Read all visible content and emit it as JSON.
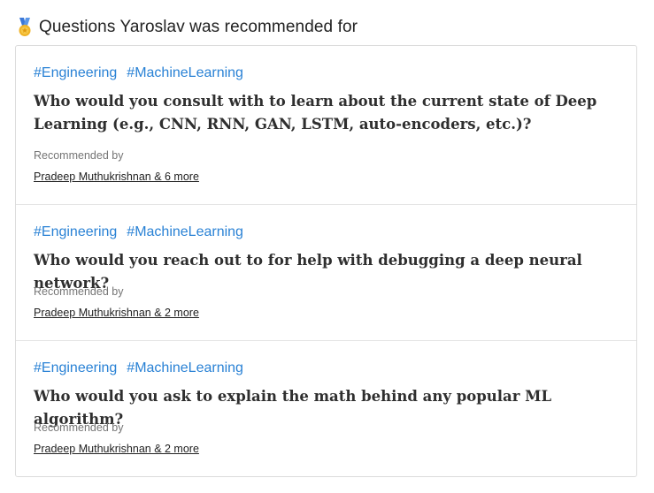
{
  "header": {
    "icon": "medal-icon",
    "title": "Questions Yaroslav was recommended for"
  },
  "colors": {
    "tag": "#2a82d5",
    "question": "#2f2f2f",
    "border": "#dcdcdc"
  },
  "questions": [
    {
      "tags": [
        "#Engineering",
        "#MachineLearning"
      ],
      "text": "Who would you consult with to learn about the current state of Deep Learning (e.g., CNN, RNN, GAN, LSTM, auto-encoders, etc.)?",
      "recommended_label": "Recommended by",
      "recommended_by": "Pradeep Muthukrishnan & 6 more"
    },
    {
      "tags": [
        "#Engineering",
        "#MachineLearning"
      ],
      "text": "Who would you reach out to for help with debugging a deep neural network?",
      "recommended_label": "Recommended by",
      "recommended_by": "Pradeep Muthukrishnan & 2 more"
    },
    {
      "tags": [
        "#Engineering",
        "#MachineLearning"
      ],
      "text": "Who would you ask to explain the math behind any popular ML algorithm?",
      "recommended_label": "Recommended by",
      "recommended_by": "Pradeep Muthukrishnan & 2 more"
    }
  ]
}
